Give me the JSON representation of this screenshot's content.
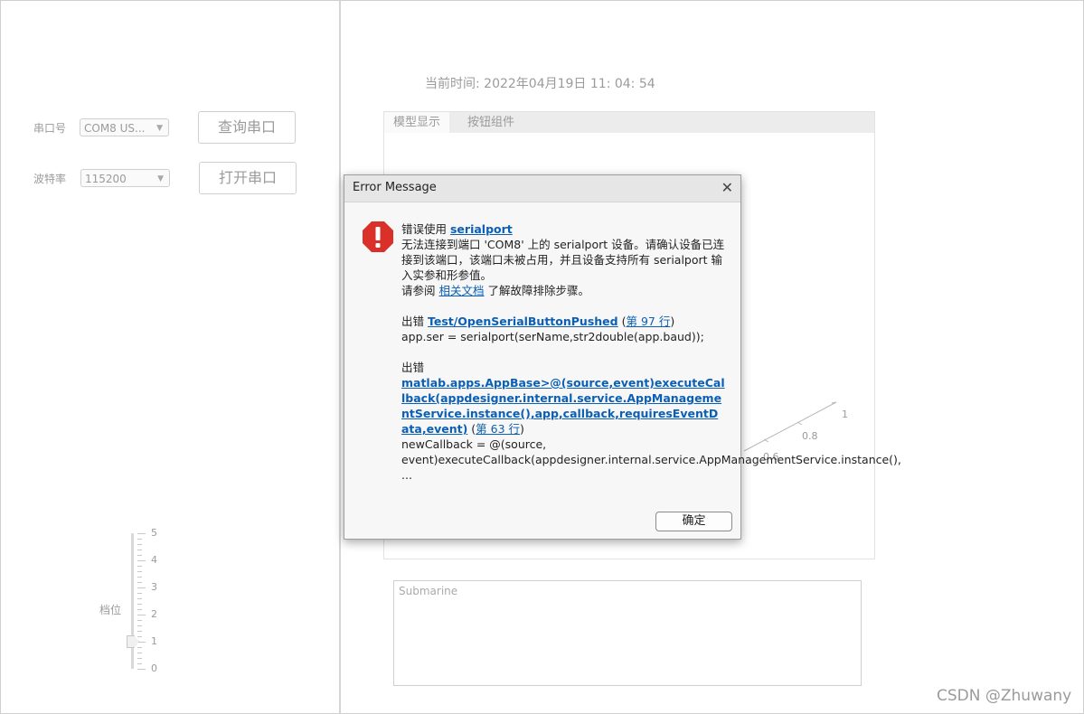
{
  "left_panel": {
    "port_label": "串口号",
    "port_value": "COM8 US...",
    "query_button": "查询串口",
    "baud_label": "波特率",
    "baud_value": "115200",
    "open_button": "打开串口",
    "gear_label": "档位",
    "slider_ticks": [
      "5",
      "4",
      "3",
      "2",
      "1",
      "0"
    ],
    "slider_value": 1
  },
  "right_panel": {
    "time_label": "当前时间: 2022年04月19日 11: 04: 54",
    "tabs": [
      {
        "label": "模型显示",
        "active": true
      },
      {
        "label": "按钮组件",
        "active": false
      }
    ],
    "axis_labels": [
      "1",
      "0.8",
      "0.6"
    ],
    "textarea_placeholder": "Submarine"
  },
  "dialog": {
    "title": "Error Message",
    "line1_prefix": "错误使用 ",
    "line1_link": "serialport",
    "body_text": "无法连接到端口 'COM8' 上的 serialport 设备。请确认设备已连接到该端口，该端口未被占用，并且设备支持所有 serialport 输入实参和形参值。",
    "see_prefix": "请参阅 ",
    "see_link": "相关文档",
    "see_suffix": " 了解故障排除步骤。",
    "err1_prefix": "出错 ",
    "err1_link": "Test/OpenSerialButtonPushed",
    "err1_line_open": " (",
    "err1_line": "第 97 行",
    "err1_line_close": ")",
    "err1_code": "app.ser = serialport(serName,str2double(app.baud));",
    "err2_prefix": "出错",
    "err2_link": "matlab.apps.AppBase>@(source,event)executeCallback(appdesigner.internal.service.AppManagementService.instance(),app,callback,requiresEventData,event)",
    "err2_line_open": " (",
    "err2_line": "第 63 行",
    "err2_line_close": ")",
    "err2_code": "newCallback = @(source, event)executeCallback(appdesigner.internal.service.AppManagementService.instance(), ...",
    "ok_button": "确定"
  },
  "watermark": "CSDN @Zhuwany",
  "colors": {
    "link": "#0b5fb5",
    "error_icon": "#d9302a",
    "disabled_text": "#9b9b9b"
  }
}
